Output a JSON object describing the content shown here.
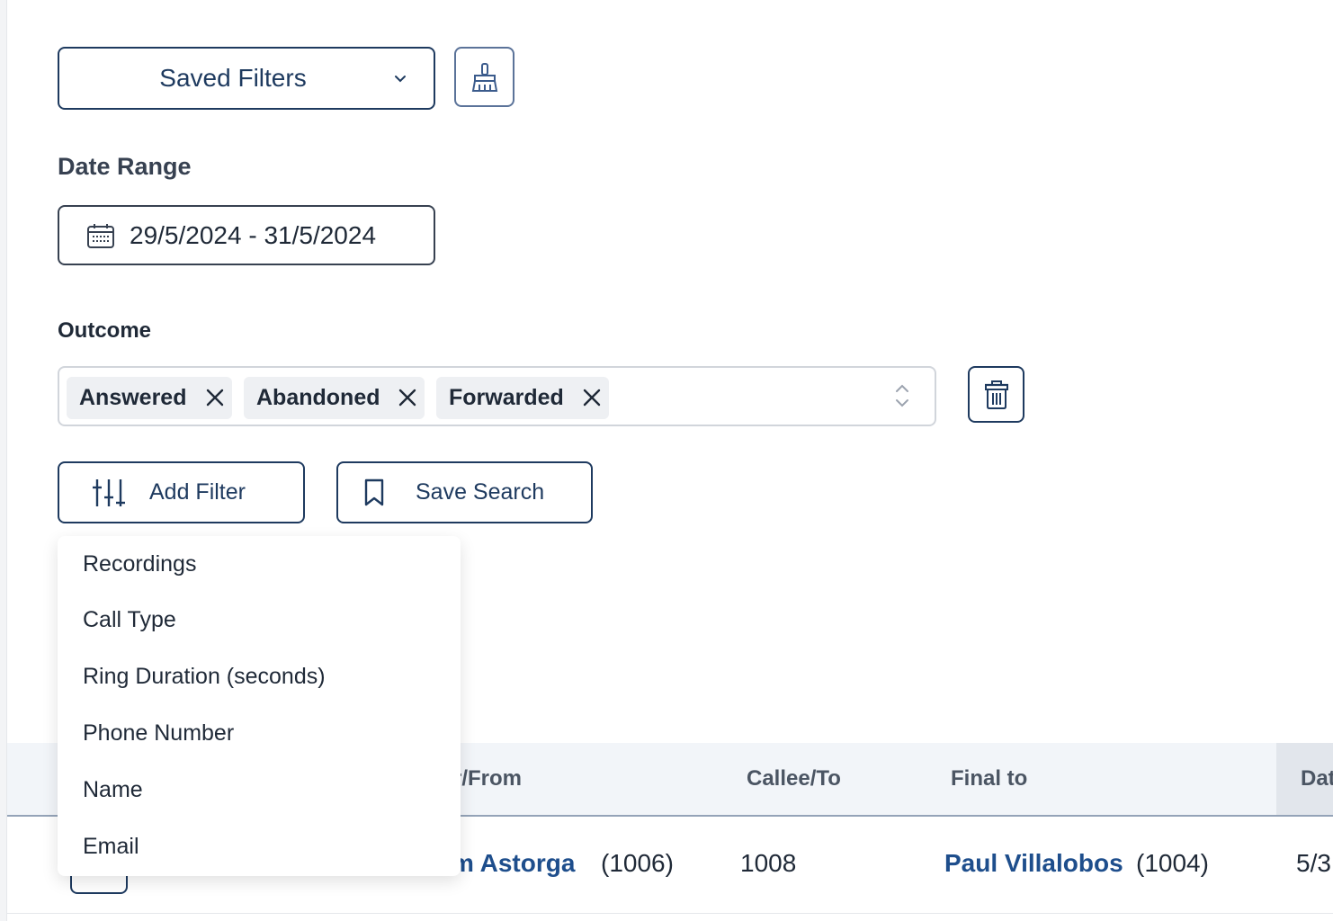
{
  "toolbar": {
    "saved_filters_label": "Saved Filters",
    "clear_icon": "broom-icon"
  },
  "date_range": {
    "label": "Date Range",
    "value": "29/5/2024 - 31/5/2024",
    "icon": "calendar-icon"
  },
  "outcome": {
    "label": "Outcome",
    "chips": [
      "Answered",
      "Abandoned",
      "Forwarded"
    ],
    "delete_icon": "trash-icon"
  },
  "actions": {
    "add_filter_label": "Add Filter",
    "save_search_label": "Save Search"
  },
  "add_filter_menu": {
    "items": [
      "Recordings",
      "Call Type",
      "Ring Duration (seconds)",
      "Phone Number",
      "Name",
      "Email"
    ]
  },
  "table": {
    "columns": [
      "r/From",
      "Callee/To",
      "Final to",
      "Dat"
    ],
    "rows": [
      {
        "from_name": "m Astorga",
        "from_ext": "(1006)",
        "callee": "1008",
        "final_name": "Paul Villalobos",
        "final_ext": "(1004)",
        "date": "5/3"
      }
    ]
  },
  "colors": {
    "primary": "#1e3a5f",
    "link": "#1e4e8c",
    "header_bg": "#f2f5f9",
    "chip_bg": "#eef0f3"
  }
}
